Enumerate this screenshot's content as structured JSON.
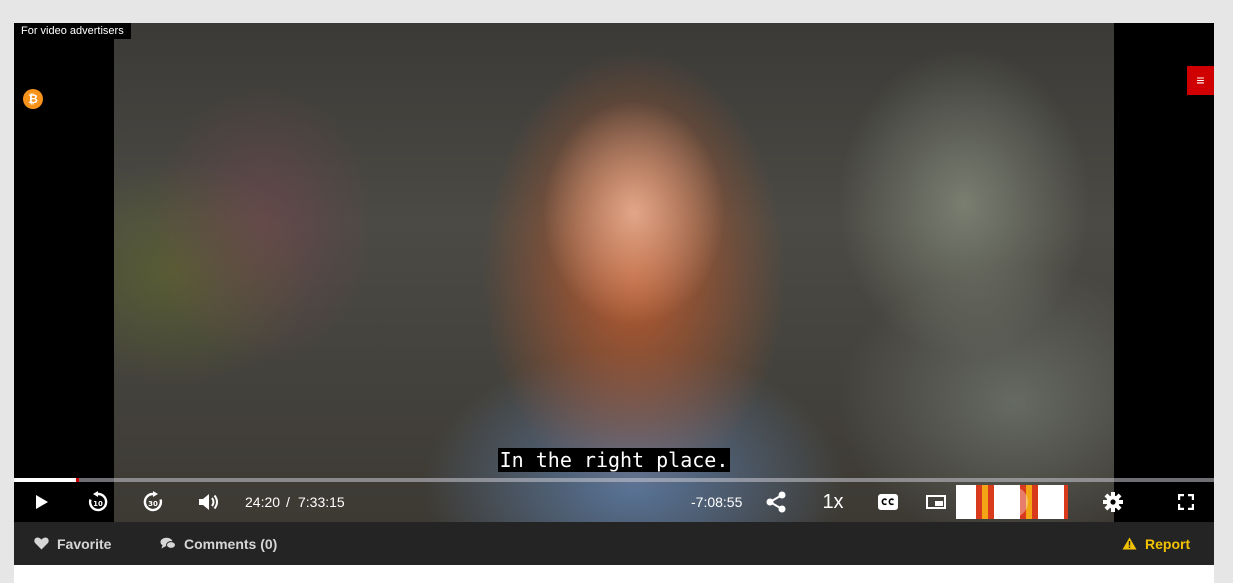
{
  "player": {
    "ad_label": "For video advertisers",
    "badge_icon": "bitcoin-icon",
    "badge_symbol": "₿",
    "menu_icon": "hamburger-icon",
    "menu_symbol": "≡",
    "subtitle": "In the right place.",
    "progress": 0.052,
    "controls": {
      "rewind_seconds": "10",
      "forward_seconds": "30",
      "current_time": "24:20",
      "time_separator": "/",
      "duration": "7:33:15",
      "remaining": "-7:08:55",
      "speed": "1x"
    }
  },
  "bottom_bar": {
    "favorite_label": "Favorite",
    "comments_label": "Comments (0)",
    "report_label": "Report"
  },
  "colors": {
    "accent_red": "#d10000",
    "report_yellow": "#f2c200",
    "bitcoin_orange": "#f7931a",
    "bar_background": "#242424"
  }
}
